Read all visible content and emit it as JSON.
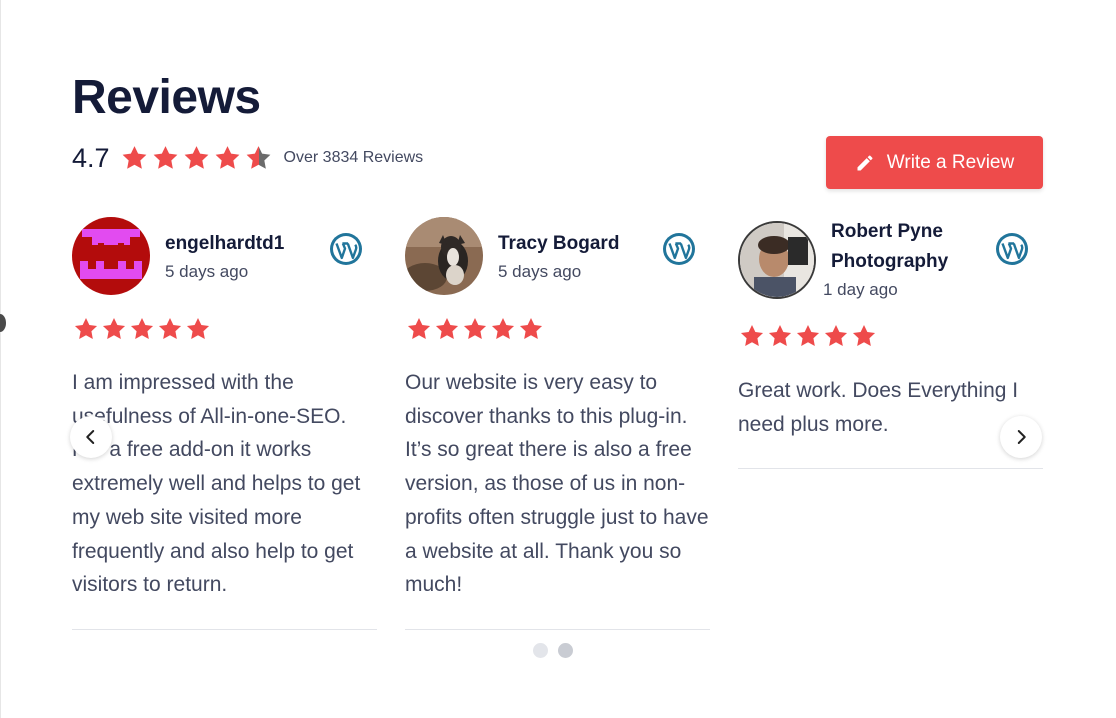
{
  "header": {
    "title": "Reviews",
    "rating": "4.7",
    "rating_value": 4.7,
    "review_count": "Over 3834 Reviews",
    "write_button": "Write a Review"
  },
  "colors": {
    "star": "#ee4b4b",
    "button": "#ee4b4b",
    "wordpress": "#21759b",
    "text": "#434960",
    "heading": "#141b38"
  },
  "reviews": [
    {
      "author": "engelhardtd1",
      "date": "5 days ago",
      "stars": 5,
      "source_icon": "wordpress-icon",
      "text": "I am impressed with the usefulness of All-in-one-SEO. For a free add-on it works extremely well and helps to get my web site visited more frequently and also help to get visitors to return."
    },
    {
      "author": "Tracy Bogard",
      "date": "5 days ago",
      "stars": 5,
      "source_icon": "wordpress-icon",
      "text": "Our website is very easy to discover thanks to this plug-in. It’s so great there is also a free version, as those of us in non-profits often struggle just to have a website at all. Thank you so much!"
    },
    {
      "author": "Robert Pyne Photography",
      "date": "1 day ago",
      "stars": 5,
      "source_icon": "wordpress-icon",
      "text": "Great work. Does Everything I need plus more."
    }
  ],
  "carousel": {
    "pages": 2,
    "active_page": 2
  }
}
